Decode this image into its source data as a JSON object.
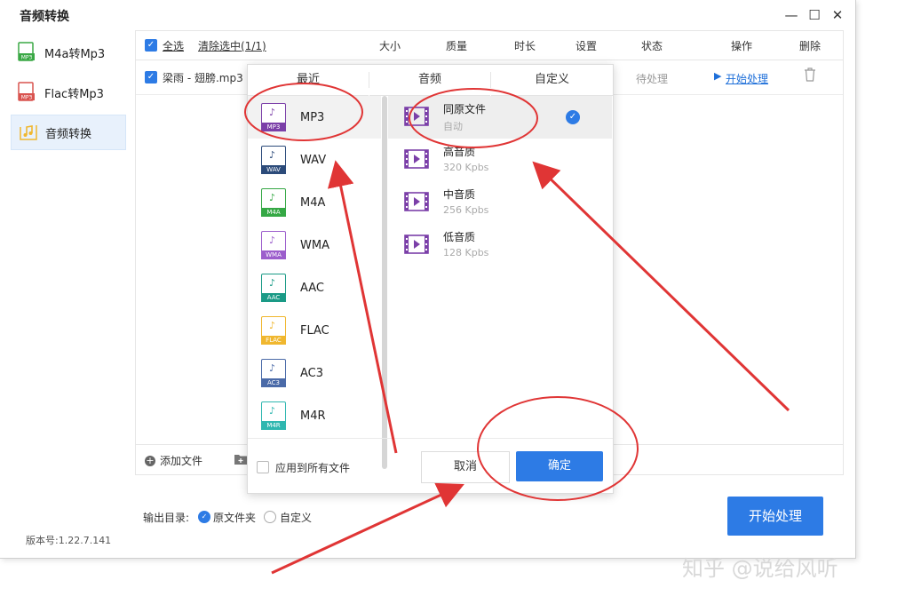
{
  "window": {
    "title": "音频转换"
  },
  "sidebar": {
    "items": [
      {
        "label": "M4a转Mp3",
        "icon": "mp3-file-icon",
        "active": false
      },
      {
        "label": "Flac转Mp3",
        "icon": "mp3-file-icon",
        "active": false
      },
      {
        "label": "音频转换",
        "icon": "music-note-icon",
        "active": true
      }
    ]
  },
  "table": {
    "select_all": "全选",
    "clear_selected": "清除选中(1/1)",
    "columns": [
      "大小",
      "质量",
      "时长",
      "设置",
      "状态",
      "操作",
      "删除"
    ],
    "rows": [
      {
        "name": "梁雨 - 翅膀.mp3",
        "status": "待处理",
        "action": "开始处理"
      }
    ]
  },
  "popup": {
    "tabs": [
      "最近",
      "音频",
      "自定义"
    ],
    "formats": [
      {
        "label": "MP3",
        "tag": "MP3",
        "color": "#7b3fa8",
        "selected": true
      },
      {
        "label": "WAV",
        "tag": "WAV",
        "color": "#2c4b7a"
      },
      {
        "label": "M4A",
        "tag": "M4A",
        "color": "#35a845"
      },
      {
        "label": "WMA",
        "tag": "WMA",
        "color": "#9c5ecc"
      },
      {
        "label": "AAC",
        "tag": "AAC",
        "color": "#1a9a86"
      },
      {
        "label": "FLAC",
        "tag": "FLAC",
        "color": "#f0b72f"
      },
      {
        "label": "AC3",
        "tag": "AC3",
        "color": "#4a6aa8"
      },
      {
        "label": "M4R",
        "tag": "M4R",
        "color": "#2fb7b0"
      }
    ],
    "qualities": [
      {
        "title": "同原文件",
        "sub": "自动",
        "selected": true
      },
      {
        "title": "高音质",
        "sub": "320 Kpbs"
      },
      {
        "title": "中音质",
        "sub": "256 Kpbs"
      },
      {
        "title": "低音质",
        "sub": "128 Kpbs"
      }
    ],
    "apply_all": "应用到所有文件",
    "cancel": "取消",
    "ok": "确定"
  },
  "footer": {
    "add_file": "添加文件",
    "output_label": "输出目录:",
    "output_original": "原文件夹",
    "output_custom": "自定义",
    "start": "开始处理",
    "version": "版本号:1.22.7.141"
  },
  "watermark": "知乎 @说给风听",
  "colors": {
    "accent": "#2d7be5",
    "annotation": "#e03535"
  }
}
